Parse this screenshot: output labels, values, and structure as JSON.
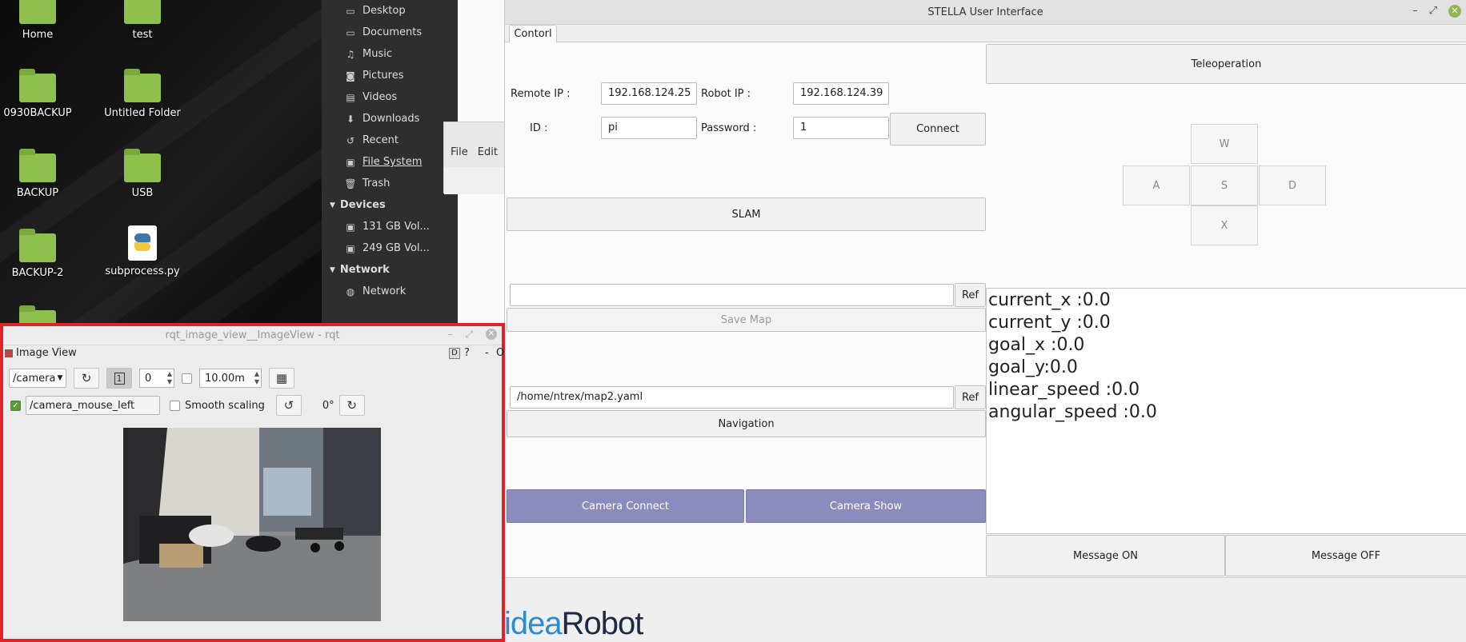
{
  "desktop": {
    "icons": [
      {
        "label": "Home",
        "type": "folder"
      },
      {
        "label": "test",
        "type": "folder"
      },
      {
        "label": "0930BACKUP",
        "type": "folder"
      },
      {
        "label": "Untitled Folder",
        "type": "folder"
      },
      {
        "label": "BACKUP",
        "type": "folder"
      },
      {
        "label": "USB",
        "type": "folder"
      },
      {
        "label": "BACKUP-2",
        "type": "folder"
      },
      {
        "label": "subprocess.py",
        "type": "python-file"
      }
    ]
  },
  "file_manager": {
    "places": [
      {
        "label": "Desktop",
        "icon": "folder-icon"
      },
      {
        "label": "Documents",
        "icon": "folder-icon"
      },
      {
        "label": "Music",
        "icon": "music-icon"
      },
      {
        "label": "Pictures",
        "icon": "camera-icon"
      },
      {
        "label": "Videos",
        "icon": "video-icon"
      },
      {
        "label": "Downloads",
        "icon": "download-icon"
      },
      {
        "label": "Recent",
        "icon": "recent-icon"
      },
      {
        "label": "File System",
        "icon": "drive-icon"
      },
      {
        "label": "Trash",
        "icon": "trash-icon"
      }
    ],
    "devices_header": "Devices",
    "devices": [
      {
        "label": "131 GB Vol...",
        "icon": "drive-icon"
      },
      {
        "label": "249 GB Vol...",
        "icon": "drive-icon"
      }
    ],
    "network_header": "Network",
    "network": [
      {
        "label": "Network",
        "icon": "globe-icon"
      }
    ],
    "bg_menu": [
      "File",
      "Edit"
    ]
  },
  "stella": {
    "title": "STELLA User Interface",
    "tab": "Contorl",
    "remote_ip_label": "Remote IP :",
    "remote_ip": "192.168.124.25",
    "robot_ip_label": "Robot IP :",
    "robot_ip": "192.168.124.39",
    "id_label": "ID :",
    "id": "pi",
    "password_label": "Password :",
    "password": "1",
    "connect": "Connect",
    "slam": "SLAM",
    "map_save_path": "",
    "ref": "Ref",
    "save_map": "Save Map",
    "map_load_path": "/home/ntrex/map2.yaml",
    "navigation": "Navigation",
    "camera_connect": "Camera Connect",
    "camera_show": "Camera Show",
    "teleoperation": "Teleoperation",
    "keys": {
      "w": "W",
      "a": "A",
      "s": "S",
      "d": "D",
      "x": "X"
    },
    "status": [
      "current_x :0.0",
      "current_y :0.0",
      "goal_x :0.0",
      "goal_y:0.0",
      "linear_speed :0.0",
      "angular_speed :0.0"
    ],
    "message_on": "Message ON",
    "message_off": "Message OFF",
    "logo_part1": "idea",
    "logo_part2": "Robot",
    "colors": {
      "camera_buttons": "#8b8bbd",
      "logo_blue": "#2f8bd0"
    }
  },
  "rqt": {
    "title": "rqt_image_view__ImageView - rqt",
    "panel_title": "Image View",
    "topic": "/camera",
    "spin_value": "0",
    "duration": "10.00m",
    "mouse_topic": "/camera_mouse_left",
    "smooth_scaling": "Smooth scaling",
    "rotation": "0°",
    "help": "?",
    "d_badge": "D",
    "dash": "-",
    "o": "O"
  }
}
